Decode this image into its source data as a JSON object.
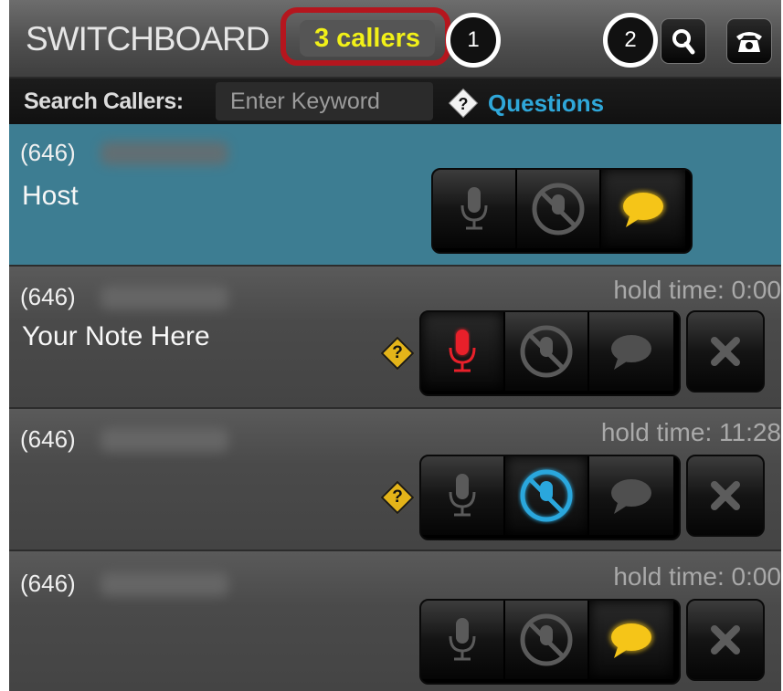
{
  "header": {
    "title": "SWITCHBOARD",
    "callers_badge": "3 callers",
    "annotation_1": "1",
    "annotation_2": "2",
    "search_icon": "magnifier-icon",
    "phone_icon": "telephone-icon"
  },
  "search": {
    "label": "Search Callers:",
    "placeholder": "Enter Keyword",
    "questions_label": "Questions"
  },
  "colors": {
    "accent_yellow": "#f1f018",
    "highlight_red": "#b5161e",
    "link_blue": "#2fa7d9",
    "active_row": "#3d7d92",
    "mic_red": "#e8202a",
    "mute_blue": "#2aa7dd",
    "chat_yellow": "#f5c518"
  },
  "callers": [
    {
      "phone": "(646)",
      "note": "Host",
      "hold_time": "",
      "selected": true,
      "mic_active": false,
      "mute_active": false,
      "chat_active": true,
      "has_question": false,
      "has_remove": false
    },
    {
      "phone": "(646)",
      "note": "Your Note Here",
      "hold_time": "hold time: 0:00",
      "selected": false,
      "mic_active": true,
      "mute_active": false,
      "chat_active": false,
      "has_question": true,
      "has_remove": true
    },
    {
      "phone": "(646)",
      "note": "",
      "hold_time": "hold time: 11:28",
      "selected": false,
      "mic_active": false,
      "mute_active": true,
      "chat_active": false,
      "has_question": true,
      "has_remove": true
    },
    {
      "phone": "(646)",
      "note": "",
      "hold_time": "hold time: 0:00",
      "selected": false,
      "mic_active": false,
      "mute_active": false,
      "chat_active": true,
      "has_question": false,
      "has_remove": true
    }
  ]
}
